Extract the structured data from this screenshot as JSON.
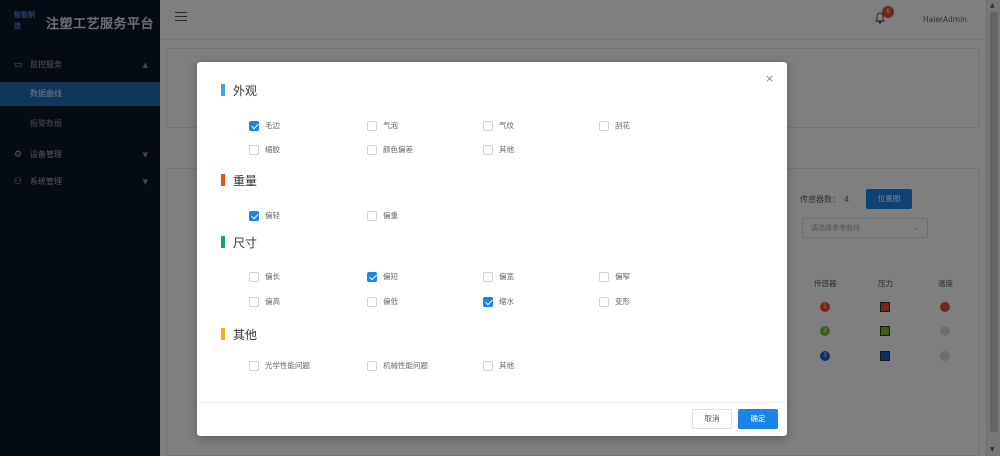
{
  "app": {
    "logo_text": "智能制造",
    "title": "注塑工艺服务平台"
  },
  "sidebar": {
    "groups": [
      {
        "label": "监控服务",
        "icon": "monitor-icon",
        "expanded": true,
        "chevron": "▲"
      },
      {
        "label": "设备管理",
        "icon": "gear-icon",
        "expanded": false,
        "chevron": "▼"
      },
      {
        "label": "系统管理",
        "icon": "users-icon",
        "expanded": false,
        "chevron": "▼"
      }
    ],
    "sub_items": [
      {
        "label": "数据曲线",
        "active": true
      },
      {
        "label": "报警数据",
        "active": false
      }
    ]
  },
  "header": {
    "badge_count": "6",
    "username": "HaierAdmin"
  },
  "background": {
    "sensor_count_label": "传感器数：",
    "sensor_count": "4",
    "sensor_button": "位置图",
    "sensor_select_placeholder": "请选择参考曲线",
    "table_headers": [
      "传感器",
      "压力",
      "温度"
    ],
    "rows": [
      {
        "index": "1",
        "color": "#e74c3c",
        "pressure_color": "#e74c3c",
        "temp_color": "#e74c3c"
      },
      {
        "index": "2",
        "color": "#7dbb2e",
        "pressure_color": "#7dbb2e",
        "temp_color": "#dddddd"
      },
      {
        "index": "3",
        "color": "#1b5fd1",
        "pressure_color": "#1b5fd1",
        "temp_color": "#dddddd"
      }
    ]
  },
  "modal": {
    "sections": [
      {
        "title": "外观",
        "color": "#4a9ee8",
        "options": [
          {
            "label": "毛边",
            "checked": true
          },
          {
            "label": "气泡",
            "checked": false
          },
          {
            "label": "气纹",
            "checked": false
          },
          {
            "label": "刮花",
            "checked": false
          },
          {
            "label": "缩胶",
            "checked": false
          },
          {
            "label": "颜色偏差",
            "checked": false
          },
          {
            "label": "其他",
            "checked": false
          }
        ]
      },
      {
        "title": "重量",
        "color": "#e8501f",
        "options": [
          {
            "label": "偏轻",
            "checked": true
          },
          {
            "label": "偏重",
            "checked": false
          }
        ]
      },
      {
        "title": "尺寸",
        "color": "#1f9a7a",
        "options": [
          {
            "label": "偏长",
            "checked": false
          },
          {
            "label": "偏短",
            "checked": true
          },
          {
            "label": "偏宽",
            "checked": false
          },
          {
            "label": "偏窄",
            "checked": false
          },
          {
            "label": "偏高",
            "checked": false
          },
          {
            "label": "偏低",
            "checked": false
          },
          {
            "label": "缩水",
            "checked": true
          },
          {
            "label": "变形",
            "checked": false
          }
        ]
      },
      {
        "title": "其他",
        "color": "#f2b01e",
        "options": [
          {
            "label": "光学性能问题",
            "checked": false
          },
          {
            "label": "机械性能问题",
            "checked": false
          },
          {
            "label": "其他",
            "checked": false
          }
        ]
      }
    ],
    "cancel_label": "取消",
    "ok_label": "确定",
    "close_glyph": "×"
  }
}
